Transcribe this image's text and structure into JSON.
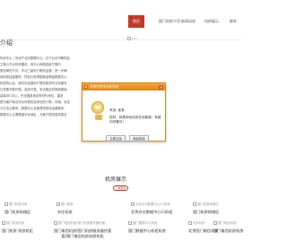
{
  "nav": {
    "items": [
      {
        "label": "首页",
        "active": true
      },
      {
        "label": "国门机房介绍",
        "active": false
      },
      {
        "label": "新闻动态",
        "active": false
      },
      {
        "label": "机房展示",
        "active": false
      },
      {
        "label": "联系"
      }
    ]
  },
  "intro": {
    "title": "介绍",
    "lines": [
      "机房中心（天地宁北京数据中心）位于北京市朝阳区",
      "立核心节点机房建设，其中心网络连接于国内",
      "国全局性节点，华北三级电力服务运营，进一步确",
      "保机房连接服务，项目已获得国家高等级数据中心",
      "机房的认证，我们向全国用户提供各项专业化服务",
      "已具备节能环保、高效可靠、安全稳定的网络基础",
      "高端IDC中心，在全国各地具有领先地位，建设",
      "是为客户和合作伙伴提供全球化的计算、存储、安全",
      "与生态云服务，数据中心全面提供电信运营服务，",
      "数据中心主要覆盖华北地区，为客户提供高效稳定"
    ],
    "image_alt": "ccc"
  },
  "dialog": {
    "title": "非常在意来访的您说",
    "name": "来自: 某某",
    "message": "您好，我是本网站的在线客服，有疑问尽管问！",
    "primary_button": "立即交谈",
    "secondary_button": "稍后再说",
    "close": "×"
  },
  "rooms": {
    "title": "机房展示",
    "more": "了解更多",
    "row1": [
      {
        "img_alt": "国门机房内景",
        "label": "国门机房网络区"
      },
      {
        "img_alt": "国门机房",
        "label": "亦庄机房"
      },
      {
        "img_alt": "北京亦庄数据中心(C)机柜",
        "label": "北京亦庄数据中心C)机柜"
      },
      {
        "img_alt": "国门机房网络区",
        "label": "国门机房网络区"
      }
    ],
    "row2": [
      {
        "img_alt": "国门机房机柜",
        "label": "国门机房 机房机柜"
      },
      {
        "img_alt": "国门电信机房/国门机房服务器托管",
        "label": "国门电信机房/国门机房服务器托管"
      },
      {
        "label2": "管/国门电信机房机房机柜"
      },
      {
        "img_alt": "国门数据中心机柜",
        "label": "国门数据中心机柜机房"
      },
      {
        "img_alt": "北京机房",
        "label": "北京国门电信机房"
      },
      {
        "img_alt": "国门电信机房",
        "label": "国门电信机房机房"
      }
    ]
  }
}
